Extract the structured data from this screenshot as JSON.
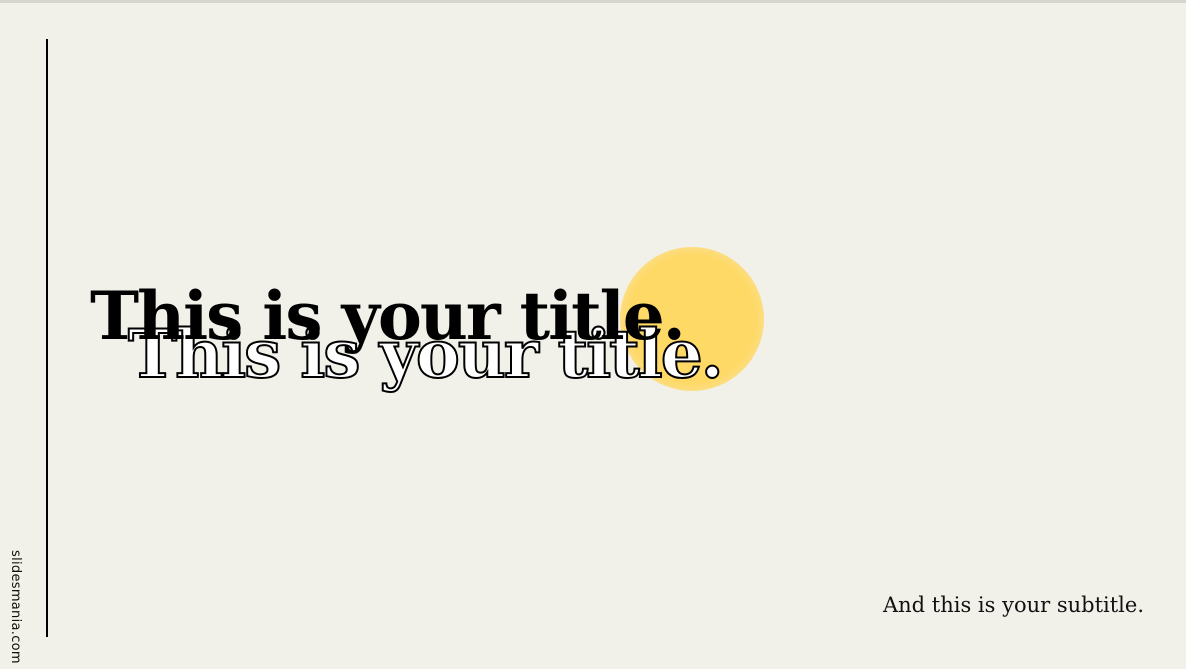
{
  "slide": {
    "title": "This is your title.",
    "title_shadow": "This is your title.",
    "subtitle": "And this is your subtitle.",
    "brand": "slidesmania.com"
  },
  "colors": {
    "background": "#f1f0e9",
    "accent_circle": "#ffd966",
    "text": "#000000"
  },
  "icons": {
    "decoration": "sun-circle"
  }
}
